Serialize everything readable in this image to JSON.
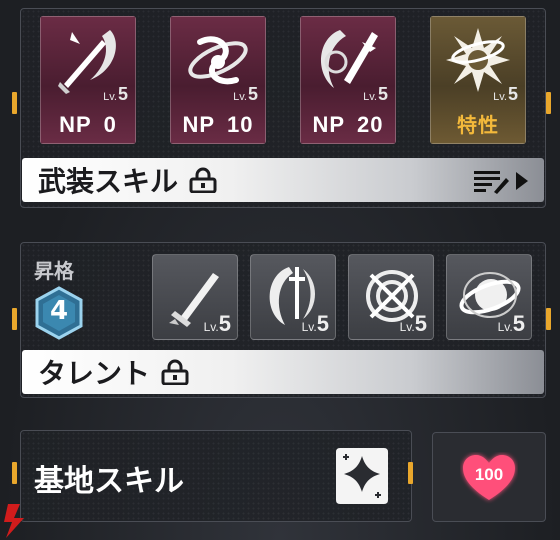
{
  "weapon_skills": {
    "cards": [
      {
        "icon": "sword-slash-icon",
        "level_prefix": "Lv.",
        "level": "5",
        "np_key": "NP",
        "np_value": "0",
        "style": "pink"
      },
      {
        "icon": "swirl-orbit-icon",
        "level_prefix": "Lv.",
        "level": "5",
        "np_key": "NP",
        "np_value": "10",
        "style": "pink"
      },
      {
        "icon": "crescent-blade-icon",
        "level_prefix": "Lv.",
        "level": "5",
        "np_key": "NP",
        "np_value": "20",
        "style": "pink"
      },
      {
        "icon": "burst-orb-icon",
        "level_prefix": "Lv.",
        "level": "5",
        "label": "特性",
        "style": "gold"
      }
    ],
    "bar_label": "武装スキル"
  },
  "ascension": {
    "label": "昇格",
    "rank": "4",
    "talents": [
      {
        "icon": "dagger-icon",
        "level_prefix": "Lv.",
        "level": "5"
      },
      {
        "icon": "moon-sword-icon",
        "level_prefix": "Lv.",
        "level": "5"
      },
      {
        "icon": "target-icon",
        "level_prefix": "Lv.",
        "level": "5"
      },
      {
        "icon": "orbit-sphere-icon",
        "level_prefix": "Lv.",
        "level": "5"
      }
    ],
    "bar_label": "タレント"
  },
  "base_skill": {
    "label": "基地スキル",
    "affection": "100"
  },
  "colors": {
    "accent": "#e9a72c",
    "np_card": "#5a2439",
    "trait_card": "#5b4c2e",
    "trait_text": "#f4b93b",
    "heart": "#ff4f7a"
  }
}
